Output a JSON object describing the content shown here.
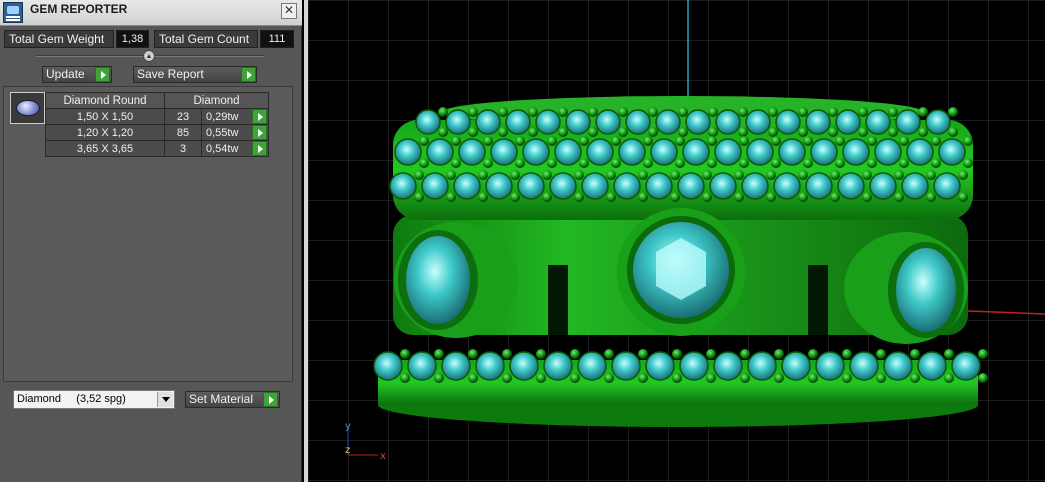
{
  "window": {
    "title": "GEM REPORTER",
    "close_symbol": "✕"
  },
  "stats": {
    "total_weight_label": "Total Gem Weight",
    "total_weight_value": "1,38",
    "total_count_label": "Total Gem Count",
    "total_count_value": "111"
  },
  "actions": {
    "update_label": "Update",
    "save_report_label": "Save Report"
  },
  "gem_table": {
    "shape_header": "Diamond Round",
    "material_header": "Diamond",
    "rows": [
      {
        "size": "1,50 X 1,50",
        "count": "23",
        "weight": "0,29tw"
      },
      {
        "size": "1,20 X 1,20",
        "count": "85",
        "weight": "0,55tw"
      },
      {
        "size": "3,65 X 3,65",
        "count": "3",
        "weight": "0,54tw"
      }
    ]
  },
  "material": {
    "selected": "Diamond     (3,52 spg)",
    "set_material_label": "Set Material"
  },
  "viewport": {
    "axis_labels": {
      "y": "y",
      "z": "z",
      "x": "x"
    },
    "colors": {
      "background": "#000000",
      "grid": "#3a3a3a",
      "metal": "#1fa51f",
      "gem": "#2fb8b8",
      "x_axis": "#c02020",
      "y_axis": "#20a0c0"
    }
  },
  "icons": {
    "app_icon": "gem-reporter-icon",
    "gem_thumbnail": "round-diamond-icon",
    "action_arrow": "play-arrow-icon",
    "dropdown": "chevron-down-icon"
  }
}
